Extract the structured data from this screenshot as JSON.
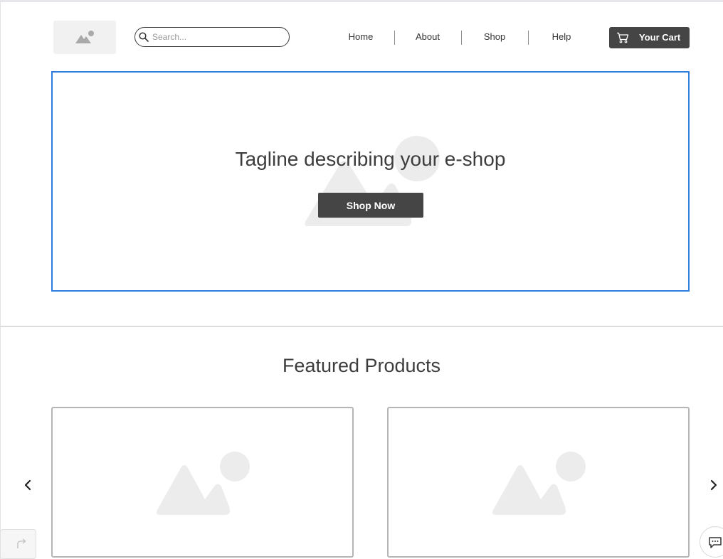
{
  "header": {
    "logo_icon": "image-placeholder-icon",
    "search": {
      "placeholder": "Search...",
      "value": "",
      "icon": "search-icon"
    },
    "nav": [
      {
        "label": "Home"
      },
      {
        "label": "About"
      },
      {
        "label": "Shop"
      },
      {
        "label": "Help"
      }
    ],
    "cart": {
      "label": "Your Cart",
      "icon": "cart-icon"
    }
  },
  "hero": {
    "tagline": "Tagline describing your e-shop",
    "button_label": "Shop Now",
    "background_icon": "image-placeholder-icon"
  },
  "featured": {
    "title": "Featured Products",
    "cards": [
      {
        "image_icon": "image-placeholder-icon"
      },
      {
        "image_icon": "image-placeholder-icon"
      }
    ],
    "prev_icon": "chevron-left-icon",
    "next_icon": "chevron-right-icon"
  },
  "floating": {
    "redo_icon": "redo-icon",
    "chat_icon": "chat-icon"
  },
  "colors": {
    "accent_border": "#2e7ee0",
    "button_dark": "#454545",
    "placeholder_gray": "#e8e8e8"
  }
}
